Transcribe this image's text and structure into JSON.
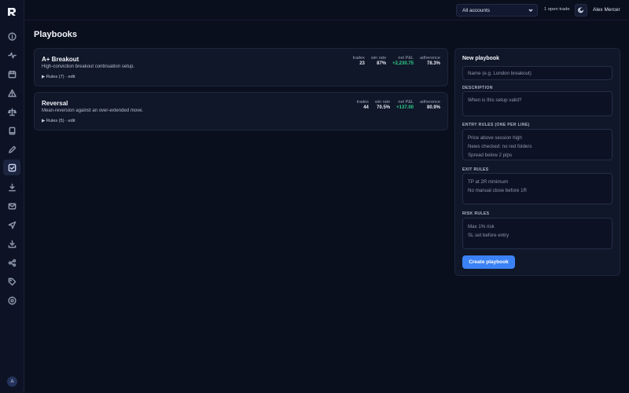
{
  "topbar": {
    "account_select": "All accounts",
    "open_trade": "1 open trade",
    "user_name": "Alex Mercer"
  },
  "sidebar": {
    "avatar_initial": "A",
    "icons": [
      "info-icon",
      "activity-icon",
      "calendar-icon",
      "alert-icon",
      "scale-icon",
      "book-icon",
      "pen-icon",
      "checklist-icon",
      "download-icon",
      "mail-icon",
      "send-icon",
      "import-icon",
      "share-icon",
      "tag-icon",
      "help-icon"
    ],
    "active": "checklist-icon"
  },
  "page": {
    "title": "Playbooks"
  },
  "playbooks": [
    {
      "name": "A+ Breakout",
      "description": "High-conviction breakout continuation setup.",
      "rules": "Rules (7) · edit",
      "stats": {
        "trades_label": "trades",
        "trades": "23",
        "winrate_label": "win rate",
        "winrate": "87%",
        "pnl_label": "net P&L",
        "pnl": "+2,230.75",
        "adherence_label": "adherence",
        "adherence": "78.3%"
      }
    },
    {
      "name": "Reversal",
      "description": "Mean-reversion against an over-extended move.",
      "rules": "Rules (5) · edit",
      "stats": {
        "trades_label": "trades",
        "trades": "44",
        "winrate_label": "win rate",
        "winrate": "70.5%",
        "pnl_label": "net P&L",
        "pnl": "+137.00",
        "adherence_label": "adherence",
        "adherence": "80.9%"
      }
    }
  ],
  "form": {
    "title": "New playbook",
    "name_placeholder": "Name (e.g. London breakout)",
    "description_label": "DESCRIPTION",
    "description_placeholder": "When is this setup valid?",
    "entry_label": "ENTRY RULES (ONE PER LINE)",
    "entry_placeholder": "Price above session high\nNews checked: no red folders\nSpread below 2 pips",
    "exit_label": "EXIT RULES",
    "exit_placeholder": "TP at 2R minimum\nNo manual close before 1R",
    "risk_label": "RISK RULES",
    "risk_placeholder": "Max 1% risk\nSL set before entry",
    "submit_label": "Create playbook"
  },
  "colors": {
    "accent": "#3b82f6",
    "positive": "#2fd08b",
    "background": "#0a0f1e"
  }
}
